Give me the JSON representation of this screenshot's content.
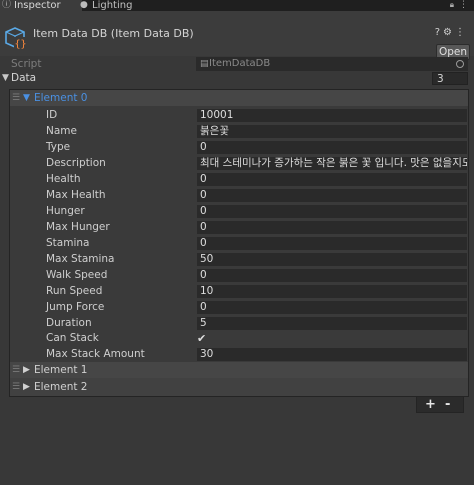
{
  "tabs": [
    {
      "label": "Inspector",
      "icon": "info-icon"
    },
    {
      "label": "Lighting",
      "icon": "bulb-icon"
    }
  ],
  "header": {
    "title": "Item Data DB (Item Data DB)",
    "open_label": "Open",
    "icons": [
      "help-icon",
      "settings-icon",
      "more-icon"
    ]
  },
  "script": {
    "label": "Script",
    "value": "ItemDataDB"
  },
  "data": {
    "label": "Data",
    "count": "3"
  },
  "elements": [
    {
      "label": "Element 0",
      "expanded": true,
      "fields": [
        {
          "label": "ID",
          "value": "10001"
        },
        {
          "label": "Name",
          "value": "붉은꽃"
        },
        {
          "label": "Type",
          "value": "0"
        },
        {
          "label": "Description",
          "value": "최대 스테미나가 증가하는 작은 붉은 꽃 입니다. 맛은 없을지도."
        },
        {
          "label": "Health",
          "value": "0"
        },
        {
          "label": "Max Health",
          "value": "0"
        },
        {
          "label": "Hunger",
          "value": "0"
        },
        {
          "label": "Max Hunger",
          "value": "0"
        },
        {
          "label": "Stamina",
          "value": "0"
        },
        {
          "label": "Max Stamina",
          "value": "50"
        },
        {
          "label": "Walk Speed",
          "value": "0"
        },
        {
          "label": "Run Speed",
          "value": "10"
        },
        {
          "label": "Jump Force",
          "value": "0"
        },
        {
          "label": "Duration",
          "value": "5"
        },
        {
          "label": "Can Stack",
          "value": "✔"
        },
        {
          "label": "Max Stack Amount",
          "value": "30"
        }
      ]
    },
    {
      "label": "Element 1",
      "expanded": false
    },
    {
      "label": "Element 2",
      "expanded": false
    }
  ],
  "footer": {
    "add": "+",
    "remove": "-"
  },
  "colors": {
    "accent": "#4a90e2",
    "background": "#383838",
    "field": "#2a2a2a"
  }
}
